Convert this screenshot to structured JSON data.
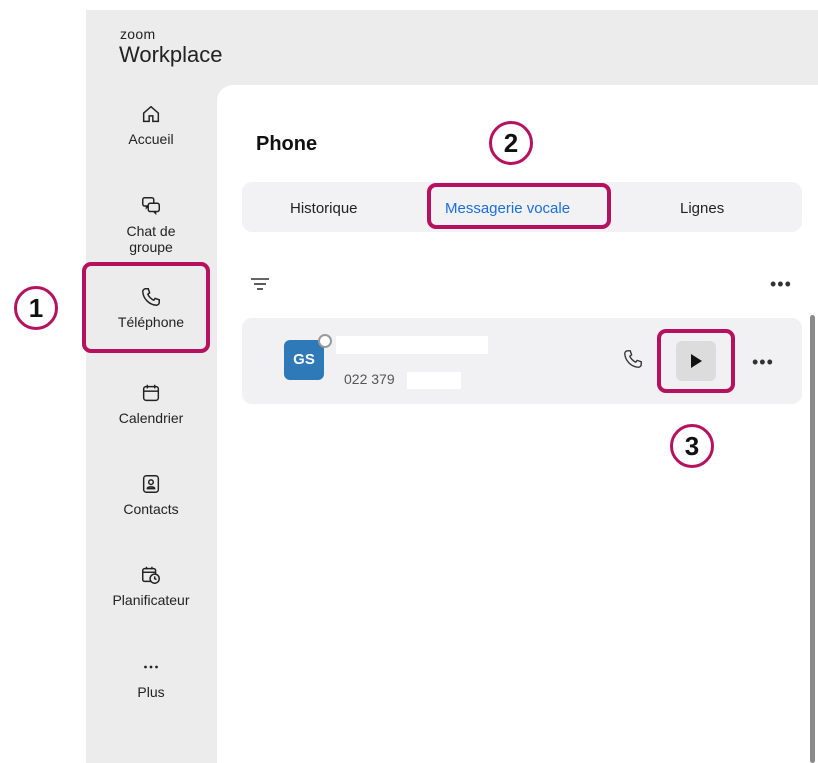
{
  "brand": {
    "line1": "zoom",
    "line2": "Workplace"
  },
  "sidebar": {
    "items": [
      {
        "label": "Accueil",
        "icon": "home-icon"
      },
      {
        "label": "Chat de groupe",
        "icon": "chat-icon"
      },
      {
        "label": "Téléphone",
        "icon": "phone-icon"
      },
      {
        "label": "Calendrier",
        "icon": "calendar-icon"
      },
      {
        "label": "Contacts",
        "icon": "contact-card-icon"
      },
      {
        "label": "Planificateur",
        "icon": "scheduler-icon"
      },
      {
        "label": "Plus",
        "icon": "more-icon"
      }
    ]
  },
  "main": {
    "title": "Phone",
    "tabs": [
      {
        "label": "Historique"
      },
      {
        "label": "Messagerie vocale",
        "active": true
      },
      {
        "label": "Lignes"
      }
    ],
    "voicemail": {
      "avatar_initials": "GS",
      "caller_number": "022 379"
    }
  },
  "callouts": [
    "1",
    "2",
    "3"
  ],
  "colors": {
    "accent_highlight": "#b5115e",
    "active_tab": "#1a6ee0",
    "avatar": "#2f79b8"
  }
}
